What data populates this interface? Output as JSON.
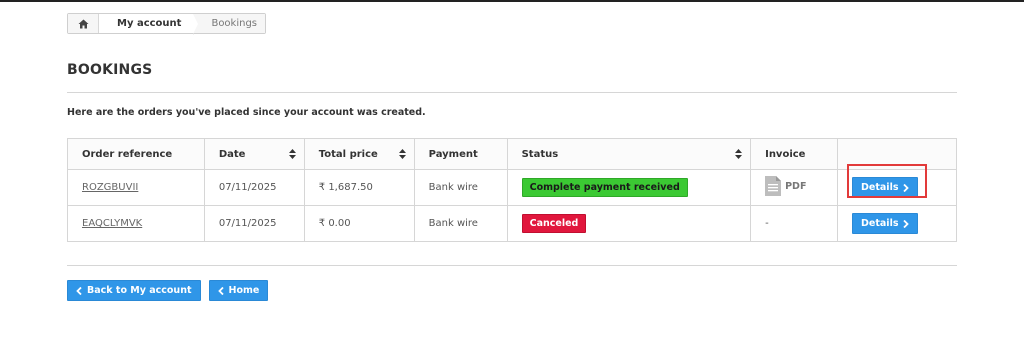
{
  "breadcrumb": {
    "my_account": "My account",
    "current": "Bookings"
  },
  "page": {
    "heading": "BOOKINGS",
    "intro": "Here are the orders you've placed since your account was created."
  },
  "table": {
    "headers": [
      "Order reference",
      "Date",
      "Total price",
      "Payment",
      "Status",
      "Invoice",
      ""
    ],
    "rows": [
      {
        "reference": "ROZGBUVII",
        "date": "07/11/2025",
        "total": "₹ 1,687.50",
        "payment": "Bank wire",
        "status": "Complete payment received",
        "status_color": "#3bc933",
        "invoice": "PDF",
        "action": "Details"
      },
      {
        "reference": "EAQCLYMVK",
        "date": "07/11/2025",
        "total": "₹ 0.00",
        "payment": "Bank wire",
        "status": "Canceled",
        "status_color": "#e1173d",
        "invoice": "-",
        "action": "Details"
      }
    ]
  },
  "footer": {
    "back_label": "Back to My account",
    "home_label": "Home"
  },
  "colors": {
    "primary_button": "#2f96e8",
    "highlight": "#e23a3a"
  }
}
